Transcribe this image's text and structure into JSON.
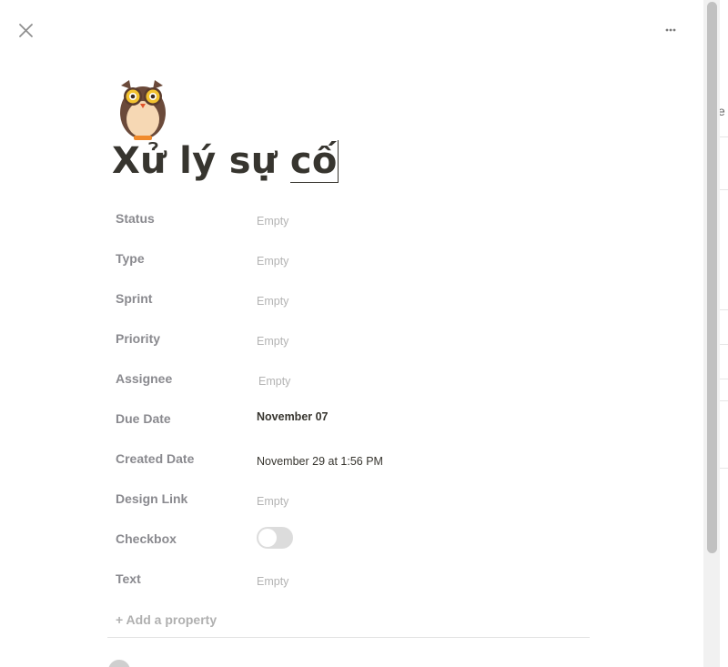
{
  "header": {
    "close_icon": "close-icon",
    "more_icon": "more-horizontal-icon"
  },
  "page": {
    "icon": "owl-icon",
    "title_main": "Xử lý sự ",
    "title_selected": "cố"
  },
  "properties": [
    {
      "label": "Status",
      "value": "Empty"
    },
    {
      "label": "Type",
      "value": "Empty"
    },
    {
      "label": "Sprint",
      "value": "Empty"
    },
    {
      "label": "Priority",
      "value": "Empty"
    },
    {
      "label": "Assignee",
      "value": "Empty"
    },
    {
      "label": "Due Date",
      "value": "November 07"
    },
    {
      "label": "Created Date",
      "value": "November 29 at 1:56 PM"
    },
    {
      "label": "Design Link",
      "value": "Empty"
    },
    {
      "label": "Checkbox",
      "value": false
    },
    {
      "label": "Text",
      "value": "Empty"
    }
  ],
  "add_property_label": "+ Add a property",
  "background_page": {
    "edge_text": "e"
  },
  "colors": {
    "title": "#37352f",
    "label": "#8a8a8f",
    "placeholder": "#b3b3b3",
    "toggle_off": "#dcdcdc",
    "owl_brown": "#6b4a3a",
    "owl_belly": "#f6d8b4",
    "owl_eye": "#f2c230",
    "owl_beak": "#f08a2c"
  }
}
